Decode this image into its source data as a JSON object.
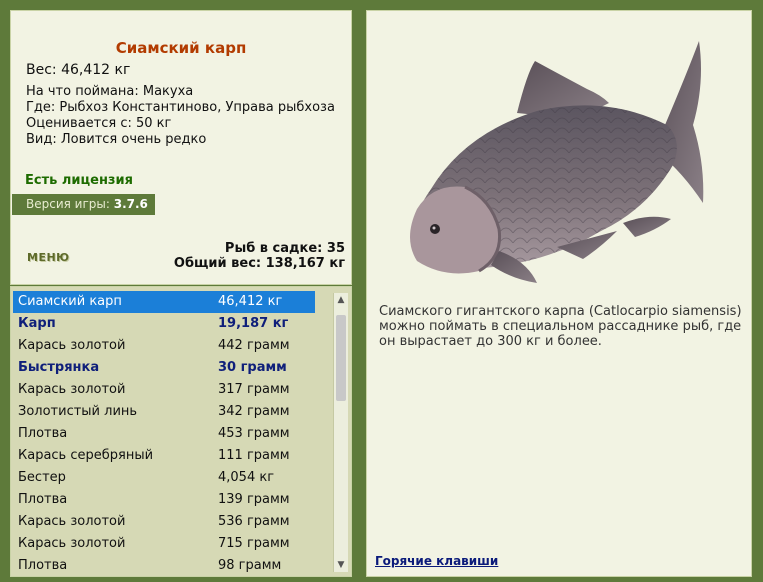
{
  "catch": {
    "name": "Сиамский карп",
    "weight": "Вес: 46,412 кг",
    "bait": "На что поймана: Макуха",
    "place": "Где: Рыбхоз Константиново, Управа рыбхоза",
    "estimate": "Оценивается с: 50 кг",
    "rarity": "Вид: Ловится очень редко"
  },
  "license": "Есть лицензия",
  "version": {
    "label": "Версия игры:",
    "value": "3.7.6"
  },
  "menu_label": "МЕНЮ",
  "stats": {
    "fish_count": "Рыб в садке: 35",
    "total_weight": "Общий вес: 138,167 кг"
  },
  "list": [
    {
      "name": "Сиамский карп",
      "weight": "46,412 кг"
    },
    {
      "name": "Карп",
      "weight": "19,187 кг"
    },
    {
      "name": "Карась золотой",
      "weight": "442 грамм"
    },
    {
      "name": "Быстрянка",
      "weight": "30 грамм"
    },
    {
      "name": "Карась золотой",
      "weight": "317 грамм"
    },
    {
      "name": "Золотистый линь",
      "weight": "342 грамм"
    },
    {
      "name": "Плотва",
      "weight": "453 грамм"
    },
    {
      "name": "Карась серебряный",
      "weight": "111 грамм"
    },
    {
      "name": "Бестер",
      "weight": "4,054 кг"
    },
    {
      "name": "Плотва",
      "weight": "139 грамм"
    },
    {
      "name": "Карась золотой",
      "weight": "536 грамм"
    },
    {
      "name": "Карась золотой",
      "weight": "715 грамм"
    },
    {
      "name": "Плотва",
      "weight": "98 грамм"
    }
  ],
  "description": "Сиамского гигантского карпа (Catlocarpio siamensis) можно поймать в специальном рассаднике рыб, где он вырастает до 300 кг и более.",
  "hotkeys_label": "Горячие клавиши",
  "icons": {
    "scroll_up": "chevron-up-icon",
    "scroll_down": "chevron-down-icon"
  },
  "colors": {
    "frame": "#5e7a3a",
    "panel": "#f2f3e3",
    "list_bg": "#d6d9b5",
    "selection": "#1b7fd8",
    "title": "#b23b00",
    "license": "#1d6b00"
  }
}
